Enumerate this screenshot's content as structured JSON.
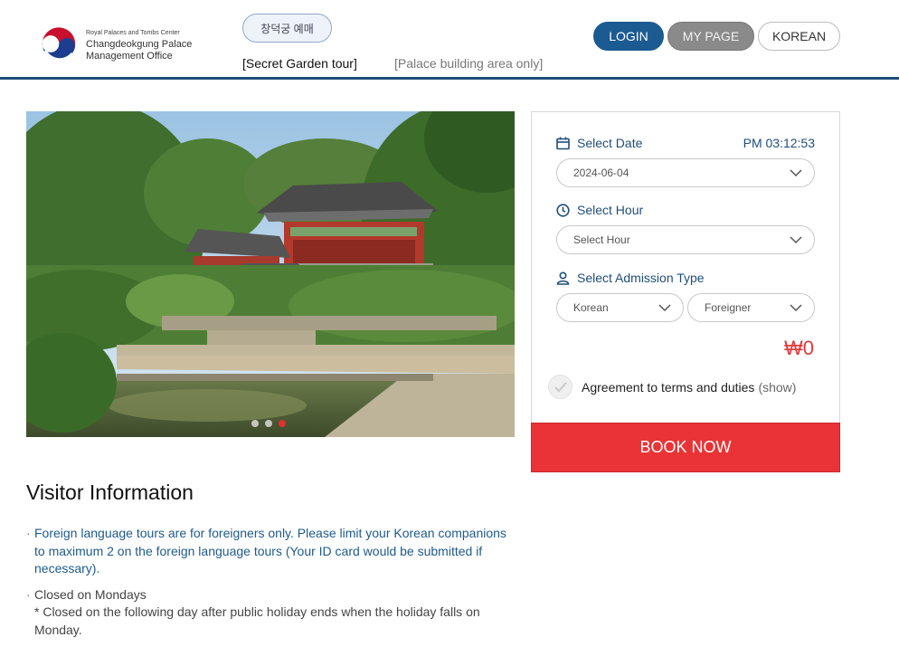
{
  "header": {
    "logo_sub": "Royal Palaces and Tombs Center",
    "logo_main_1": "Changdeokgung Palace",
    "logo_main_2": "Management Office",
    "korean_pill_label": "창덕궁 예매",
    "nav_secret_label": "[Secret Garden tour]",
    "nav_palace_label": "[Palace building area only]",
    "login_label": "LOGIN",
    "mypage_label": "MY PAGE",
    "lang_label": "KOREAN"
  },
  "carousel": {
    "slide_count": 3,
    "active_index": 2
  },
  "booking": {
    "select_date_label": "Select Date",
    "current_time": "PM 03:12:53",
    "date_value": "2024-06-04",
    "select_hour_label": "Select Hour",
    "hour_placeholder": "Select Hour",
    "admission_label": "Select Admission Type",
    "korean_option": "Korean",
    "foreigner_option": "Foreigner",
    "price": "₩0",
    "agree_label": "Agreement to terms and duties",
    "agree_show": "(show)",
    "book_label": "BOOK NOW"
  },
  "visitor_info": {
    "title": "Visitor Information",
    "items": [
      "Foreign language tours are for foreigners only. Please limit your Korean companions to maximum 2 on the foreign language tours (Your ID card would be submitted if necessary).",
      "Closed on Mondays"
    ],
    "note": "* Closed on the following day after public holiday ends when the holiday falls on Monday."
  },
  "colors": {
    "brand_navy": "#1f4e79",
    "login_blue": "#1c5a92",
    "book_red": "#ea3336",
    "price_red": "#e03a3a"
  }
}
